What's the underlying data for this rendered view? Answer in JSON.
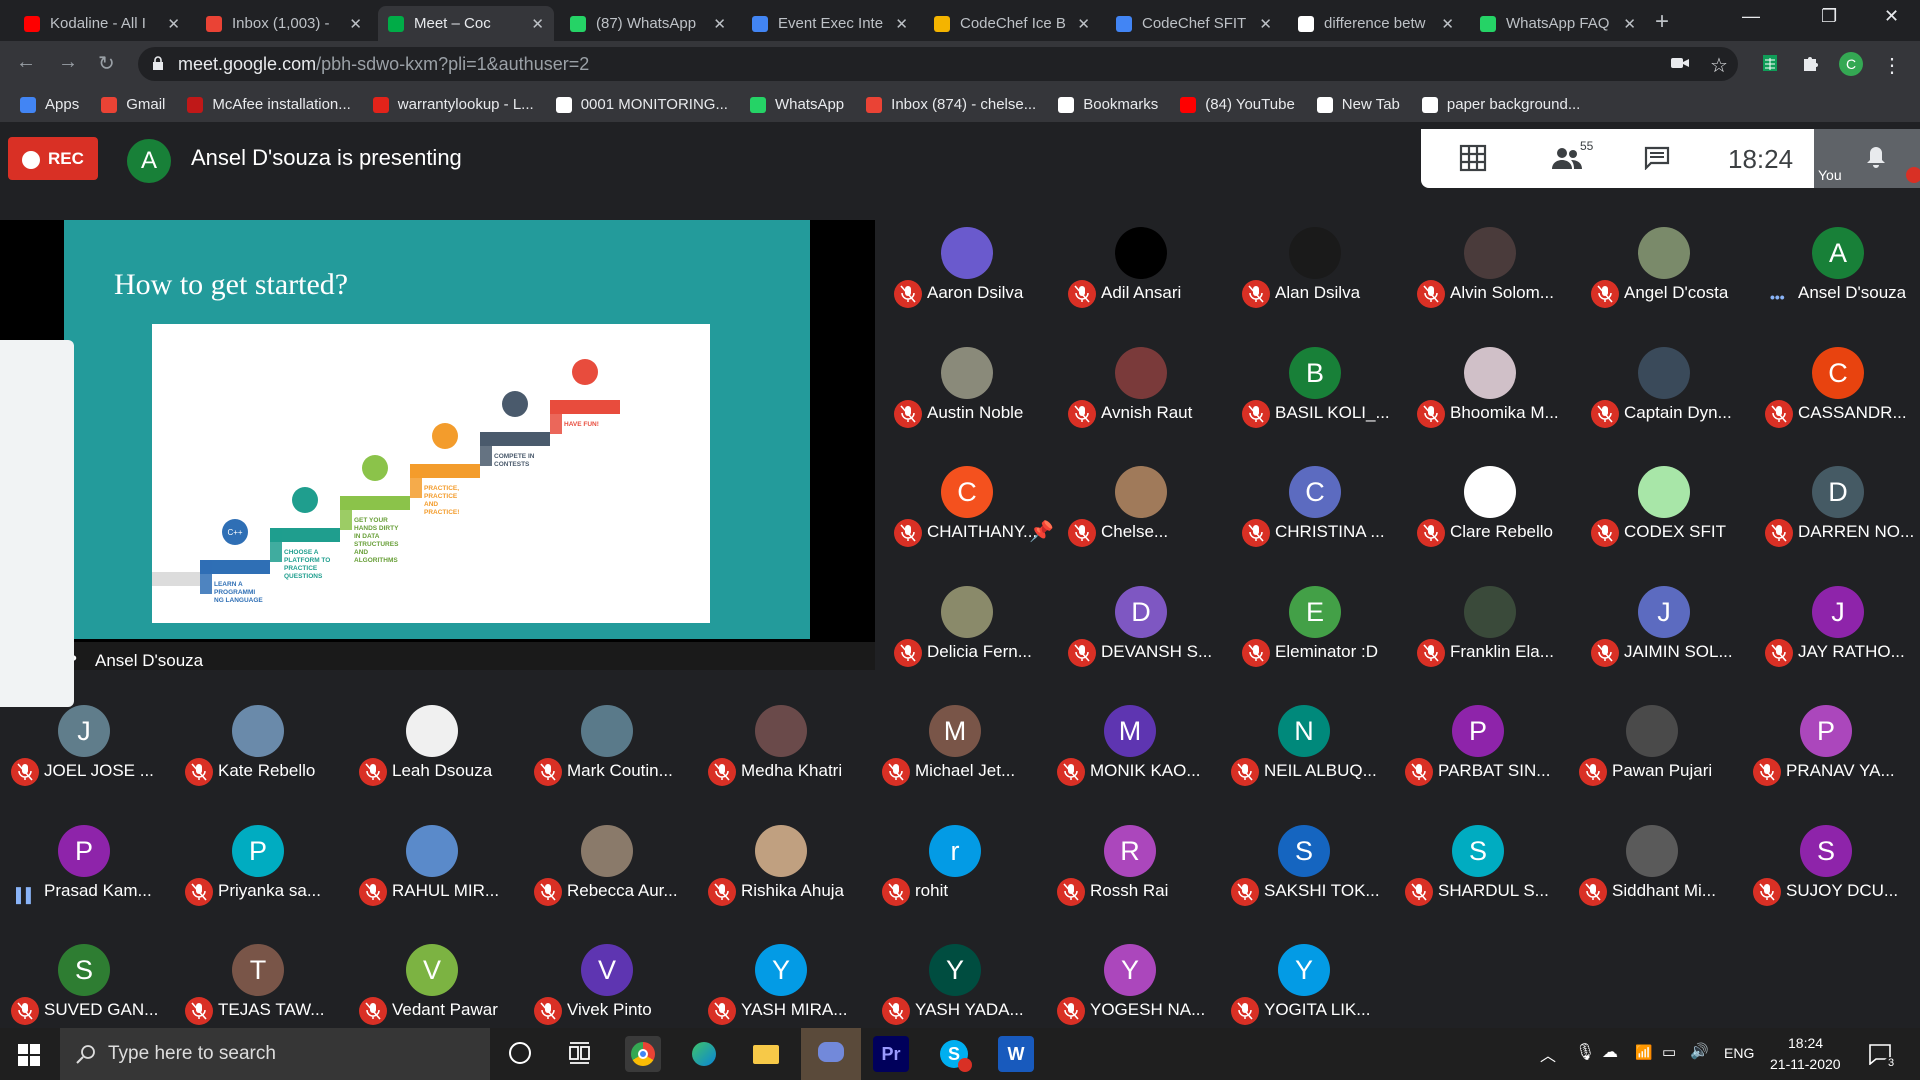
{
  "browser": {
    "tabs": [
      {
        "title": "Kodaline - All I",
        "favicon": "youtube-icon",
        "color": "#ff0000"
      },
      {
        "title": "Inbox (1,003) -",
        "favicon": "gmail-icon",
        "color": "#ea4335"
      },
      {
        "title": "Meet – Coc",
        "favicon": "meet-icon",
        "color": "#00ac47",
        "active": true
      },
      {
        "title": "(87) WhatsApp",
        "favicon": "whatsapp-icon",
        "color": "#25d366"
      },
      {
        "title": "Event Exec Inte",
        "favicon": "docs-icon",
        "color": "#4285f4"
      },
      {
        "title": "CodeChef Ice B",
        "favicon": "slides-icon",
        "color": "#f4b400"
      },
      {
        "title": "CodeChef SFIT",
        "favicon": "docs-icon",
        "color": "#4285f4"
      },
      {
        "title": "difference betw",
        "favicon": "google-icon",
        "color": "#ffffff"
      },
      {
        "title": "WhatsApp FAQ",
        "favicon": "whatsapp-icon",
        "color": "#25d366"
      }
    ],
    "url_host": "meet.google.com",
    "url_path": "/pbh-sdwo-kxm?pli=1&authuser=2",
    "profile_initial": "C",
    "bookmarks": [
      {
        "label": "Apps",
        "icon": "apps-grid-icon",
        "color": "#4285f4"
      },
      {
        "label": "Gmail",
        "icon": "gmail-icon",
        "color": "#ea4335"
      },
      {
        "label": "McAfee installation...",
        "icon": "mcafee-icon",
        "color": "#c01818"
      },
      {
        "label": "warrantylookup - L...",
        "icon": "lenovo-icon",
        "color": "#e2231a"
      },
      {
        "label": "0001 MONITORING...",
        "icon": "doc-icon",
        "color": "#ffffff"
      },
      {
        "label": "WhatsApp",
        "icon": "whatsapp-icon",
        "color": "#25d366"
      },
      {
        "label": "Inbox (874) - chelse...",
        "icon": "gmail-icon",
        "color": "#ea4335"
      },
      {
        "label": "Bookmarks",
        "icon": "star-icon",
        "color": "#ffffff"
      },
      {
        "label": "(84) YouTube",
        "icon": "youtube-icon",
        "color": "#ff0000"
      },
      {
        "label": "New Tab",
        "icon": "globe-icon",
        "color": "#ffffff"
      },
      {
        "label": "paper background...",
        "icon": "google-icon",
        "color": "#ffffff"
      }
    ]
  },
  "meet": {
    "rec_label": "REC",
    "presenter_initial": "A",
    "presenter_status": "Ansel D'souza is presenting",
    "participant_count": "55",
    "clock": "18:24",
    "self_label": "You",
    "presentation_owner": "Ansel D'souza",
    "slide": {
      "title": "How to get started?",
      "steps": [
        {
          "text": "LEARN A PROGRAMMI NG LANGUAGE",
          "color": "#2f6fb5",
          "icon": "C++"
        },
        {
          "text": "CHOOSE A PLATFORM TO PRACTICE QUESTIONS",
          "color": "#1f9e8e",
          "icon": ""
        },
        {
          "text": "GET YOUR HANDS DIRTY IN DATA STRUCTURES AND ALGORITHMS",
          "color": "#8bc34a",
          "icon": ""
        },
        {
          "text": "PRACTICE, PRACTICE AND PRACTICE!",
          "color": "#f39c2c",
          "icon": ""
        },
        {
          "text": "COMPETE IN CONTESTS",
          "color": "#4a5a6c",
          "icon": ""
        },
        {
          "text": "HAVE FUN!",
          "color": "#e84c3d",
          "icon": ""
        }
      ]
    },
    "participants": [
      {
        "name": "Aaron Dsilva",
        "initial": "",
        "color": "#6a5acd",
        "photo": true
      },
      {
        "name": "Adil Ansari",
        "initial": "",
        "color": "#000000",
        "photo": true
      },
      {
        "name": "Alan Dsilva",
        "initial": "",
        "color": "#1a1a1a",
        "photo": true
      },
      {
        "name": "Alvin Solom...",
        "initial": "",
        "color": "#4a3b3b",
        "photo": true
      },
      {
        "name": "Angel D'costa",
        "initial": "",
        "color": "#7a8a6a",
        "photo": true
      },
      {
        "name": "Ansel D'souza",
        "initial": "A",
        "color": "#188038",
        "talking": true
      },
      {
        "name": "Austin Noble",
        "initial": "",
        "color": "#8a8a7a",
        "photo": true
      },
      {
        "name": "Avnish Raut",
        "initial": "",
        "color": "#7a3a3a",
        "photo": true
      },
      {
        "name": "BASIL KOLI_...",
        "initial": "B",
        "color": "#188038"
      },
      {
        "name": "Bhoomika M...",
        "initial": "",
        "color": "#d0c0c8",
        "photo": true
      },
      {
        "name": "Captain Dyn...",
        "initial": "",
        "color": "#3a4a5a",
        "photo": true
      },
      {
        "name": "CASSANDR...",
        "initial": "C",
        "color": "#e8430f"
      },
      {
        "name": "CHAITHANY...",
        "initial": "C",
        "color": "#f4511e"
      },
      {
        "name": "Chelse...",
        "initial": "",
        "color": "#a07a5a",
        "photo": true,
        "pinned": true
      },
      {
        "name": "CHRISTINA ...",
        "initial": "C",
        "color": "#5c6bc0"
      },
      {
        "name": "Clare Rebello",
        "initial": "",
        "color": "#ffffff",
        "photo": true
      },
      {
        "name": "CODEX SFIT",
        "initial": "",
        "color": "#a8e6a8",
        "photo": true
      },
      {
        "name": "DARREN NO...",
        "initial": "D",
        "color": "#455a64"
      },
      {
        "name": "Delicia Fern...",
        "initial": "",
        "color": "#8a8a6a",
        "photo": true
      },
      {
        "name": "DEVANSH S...",
        "initial": "D",
        "color": "#7e57c2"
      },
      {
        "name": "Eleminator :D",
        "initial": "E",
        "color": "#43a047"
      },
      {
        "name": "Franklin Ela...",
        "initial": "",
        "color": "#3a4a3a",
        "photo": true
      },
      {
        "name": "JAIMIN SOL...",
        "initial": "J",
        "color": "#5c6bc0"
      },
      {
        "name": "JAY RATHO...",
        "initial": "J",
        "color": "#8e24aa"
      },
      {
        "name": "JOEL JOSE ...",
        "initial": "J",
        "color": "#607d8b"
      },
      {
        "name": "Kate Rebello",
        "initial": "",
        "color": "#6a8aaa",
        "photo": true
      },
      {
        "name": "Leah Dsouza",
        "initial": "",
        "color": "#f0f0f0",
        "photo": true
      },
      {
        "name": "Mark Coutin...",
        "initial": "",
        "color": "#5a7a8a",
        "photo": true
      },
      {
        "name": "Medha Khatri",
        "initial": "",
        "color": "#6a4a4a",
        "photo": true
      },
      {
        "name": "Michael Jet...",
        "initial": "M",
        "color": "#795548"
      },
      {
        "name": "MONIK KAO...",
        "initial": "M",
        "color": "#5e35b1"
      },
      {
        "name": "NEIL ALBUQ...",
        "initial": "N",
        "color": "#00897b"
      },
      {
        "name": "PARBAT SIN...",
        "initial": "P",
        "color": "#8e24aa"
      },
      {
        "name": "Pawan Pujari",
        "initial": "",
        "color": "#4a4a4a",
        "photo": true
      },
      {
        "name": "PRANAV YA...",
        "initial": "P",
        "color": "#ab47bc"
      },
      {
        "name": "Prasad Kam...",
        "initial": "P",
        "color": "#8e24aa",
        "talking": true
      },
      {
        "name": "Priyanka sa...",
        "initial": "P",
        "color": "#00acc1"
      },
      {
        "name": "RAHUL MIR...",
        "initial": "",
        "color": "#5a8aca",
        "photo": true
      },
      {
        "name": "Rebecca Aur...",
        "initial": "",
        "color": "#8a7a6a",
        "photo": true
      },
      {
        "name": "Rishika Ahuja",
        "initial": "",
        "color": "#c0a080",
        "photo": true
      },
      {
        "name": "rohit",
        "initial": "r",
        "color": "#039be5"
      },
      {
        "name": "Rossh Rai",
        "initial": "R",
        "color": "#ab47bc"
      },
      {
        "name": "SAKSHI TOK...",
        "initial": "S",
        "color": "#1565c0"
      },
      {
        "name": "SHARDUL S...",
        "initial": "S",
        "color": "#00acc1"
      },
      {
        "name": "Siddhant Mi...",
        "initial": "",
        "color": "#5a5a5a",
        "photo": true
      },
      {
        "name": "SUJOY DCU...",
        "initial": "S",
        "color": "#8e24aa"
      },
      {
        "name": "SUVED GAN...",
        "initial": "S",
        "color": "#2e7d32"
      },
      {
        "name": "TEJAS TAW...",
        "initial": "T",
        "color": "#795548"
      },
      {
        "name": "Vedant Pawar",
        "initial": "V",
        "color": "#7cb342"
      },
      {
        "name": "Vivek Pinto",
        "initial": "V",
        "color": "#5e35b1"
      },
      {
        "name": "YASH MIRA...",
        "initial": "Y",
        "color": "#039be5"
      },
      {
        "name": "YASH YADA...",
        "initial": "Y",
        "color": "#004d40"
      },
      {
        "name": "YOGESH NA...",
        "initial": "Y",
        "color": "#ab47bc"
      },
      {
        "name": "YOGITA LIK...",
        "initial": "Y",
        "color": "#039be5"
      }
    ]
  },
  "taskbar": {
    "search_placeholder": "Type here to search",
    "language": "ENG",
    "time": "18:24",
    "date": "21-11-2020",
    "notifications": "3"
  }
}
